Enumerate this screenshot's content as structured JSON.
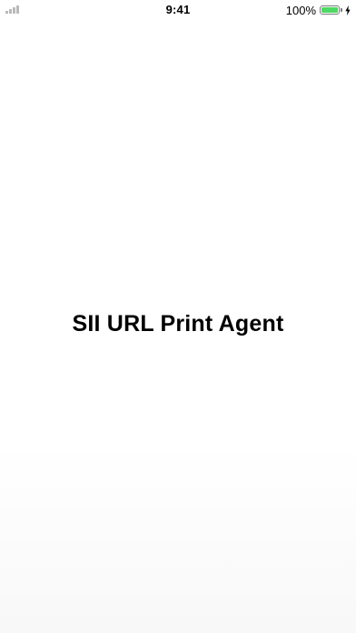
{
  "status_bar": {
    "time": "9:41",
    "battery_percent_label": "100%",
    "battery_level": 1.0,
    "battery_color": "#4cd964",
    "signal_icon": "cellular-signal-icon",
    "charging_icon": "charging-bolt-icon"
  },
  "main": {
    "title": "SII URL Print Agent"
  }
}
